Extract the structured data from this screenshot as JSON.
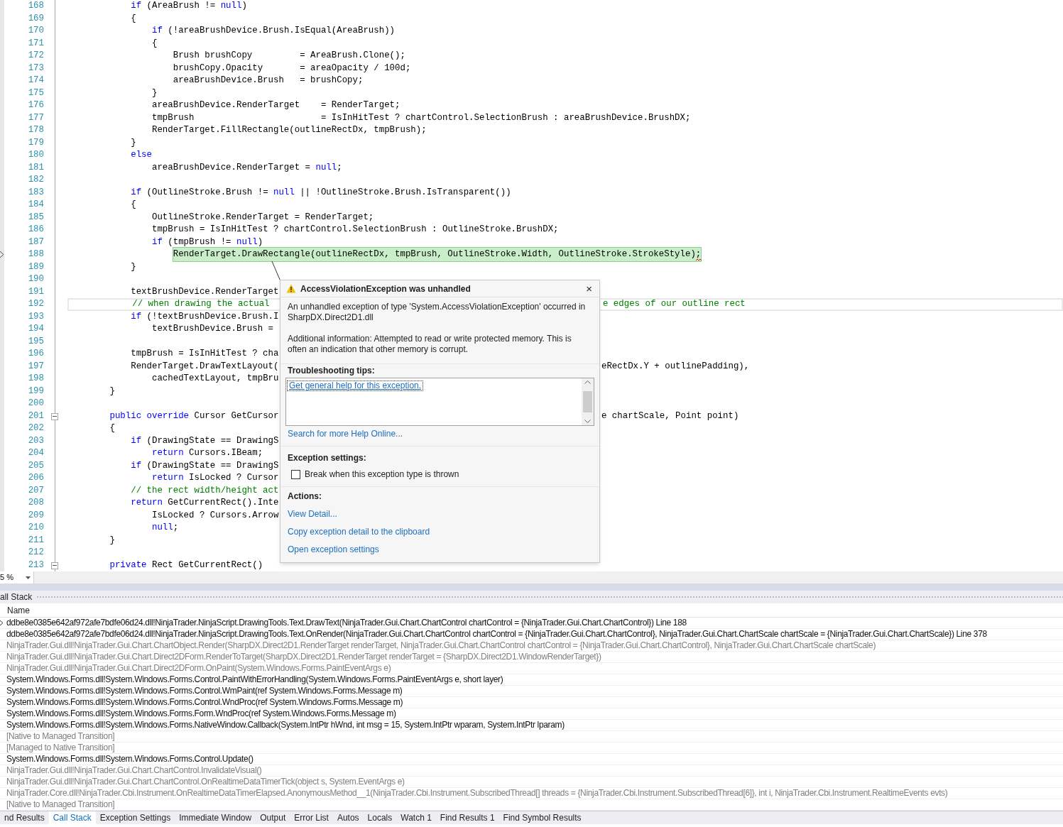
{
  "editor": {
    "lines": [
      {
        "number": "168",
        "fold": false,
        "cursor": false,
        "current": false,
        "parts": [
          {
            "text": "            if",
            "kind": "kw"
          },
          {
            "text": " (AreaBrush != ",
            "kind": "plain"
          },
          {
            "text": "null",
            "kind": "kw"
          },
          {
            "text": ")",
            "kind": "plain"
          }
        ]
      },
      {
        "number": "169",
        "fold": false,
        "cursor": false,
        "current": false,
        "parts": [
          {
            "text": "            {",
            "kind": "plain"
          }
        ]
      },
      {
        "number": "170",
        "fold": false,
        "cursor": false,
        "current": false,
        "parts": [
          {
            "text": "                if",
            "kind": "kw"
          },
          {
            "text": " (!areaBrushDevice.Brush.IsEqual(AreaBrush))",
            "kind": "plain"
          }
        ]
      },
      {
        "number": "171",
        "fold": false,
        "cursor": false,
        "current": false,
        "parts": [
          {
            "text": "                {",
            "kind": "plain"
          }
        ]
      },
      {
        "number": "172",
        "fold": false,
        "cursor": false,
        "current": false,
        "parts": [
          {
            "text": "                    Brush brushCopy         = AreaBrush.Clone();",
            "kind": "plain"
          }
        ]
      },
      {
        "number": "173",
        "fold": false,
        "cursor": false,
        "current": false,
        "parts": [
          {
            "text": "                    brushCopy.Opacity       = areaOpacity / 100d;",
            "kind": "plain"
          }
        ]
      },
      {
        "number": "174",
        "fold": false,
        "cursor": false,
        "current": false,
        "parts": [
          {
            "text": "                    areaBrushDevice.Brush   = brushCopy;",
            "kind": "plain"
          }
        ]
      },
      {
        "number": "175",
        "fold": false,
        "cursor": false,
        "current": false,
        "parts": [
          {
            "text": "                }",
            "kind": "plain"
          }
        ]
      },
      {
        "number": "176",
        "fold": false,
        "cursor": false,
        "current": false,
        "parts": [
          {
            "text": "                areaBrushDevice.RenderTarget    = RenderTarget;",
            "kind": "plain"
          }
        ]
      },
      {
        "number": "177",
        "fold": false,
        "cursor": false,
        "current": false,
        "parts": [
          {
            "text": "                tmpBrush                        = IsInHitTest ? chartControl.SelectionBrush : areaBrushDevice.BrushDX;",
            "kind": "plain"
          }
        ]
      },
      {
        "number": "178",
        "fold": false,
        "cursor": false,
        "current": false,
        "parts": [
          {
            "text": "                RenderTarget.FillRectangle(outlineRectDx, tmpBrush);",
            "kind": "plain"
          }
        ]
      },
      {
        "number": "179",
        "fold": false,
        "cursor": false,
        "current": false,
        "parts": [
          {
            "text": "            }",
            "kind": "plain"
          }
        ]
      },
      {
        "number": "180",
        "fold": false,
        "cursor": false,
        "current": false,
        "parts": [
          {
            "text": "            else",
            "kind": "kw"
          }
        ]
      },
      {
        "number": "181",
        "fold": false,
        "cursor": false,
        "current": false,
        "parts": [
          {
            "text": "                areaBrushDevice.RenderTarget = ",
            "kind": "plain"
          },
          {
            "text": "null",
            "kind": "kw"
          },
          {
            "text": ";",
            "kind": "plain"
          }
        ]
      },
      {
        "number": "182",
        "fold": false,
        "cursor": false,
        "current": false
      },
      {
        "number": "183",
        "fold": false,
        "cursor": false,
        "current": false,
        "parts": [
          {
            "text": "            if",
            "kind": "kw"
          },
          {
            "text": " (OutlineStroke.Brush != ",
            "kind": "plain"
          },
          {
            "text": "null",
            "kind": "kw"
          },
          {
            "text": " || !OutlineStroke.Brush.IsTransparent())",
            "kind": "plain"
          }
        ]
      },
      {
        "number": "184",
        "fold": false,
        "cursor": false,
        "current": false,
        "parts": [
          {
            "text": "            {",
            "kind": "plain"
          }
        ]
      },
      {
        "number": "185",
        "fold": false,
        "cursor": false,
        "current": false,
        "parts": [
          {
            "text": "                OutlineStroke.RenderTarget = RenderTarget;",
            "kind": "plain"
          }
        ]
      },
      {
        "number": "186",
        "fold": false,
        "cursor": false,
        "current": false,
        "parts": [
          {
            "text": "                tmpBrush = IsInHitTest ? chartControl.SelectionBrush : OutlineStroke.BrushDX;",
            "kind": "plain"
          }
        ]
      },
      {
        "number": "187",
        "fold": false,
        "cursor": false,
        "current": false,
        "parts": [
          {
            "text": "                if",
            "kind": "kw"
          },
          {
            "text": " (tmpBrush != ",
            "kind": "plain"
          },
          {
            "text": "null",
            "kind": "kw"
          },
          {
            "text": ")",
            "kind": "plain"
          }
        ]
      },
      {
        "number": "188",
        "fold": false,
        "cursor": false,
        "current": true,
        "parts": [
          {
            "text": "                    RenderTarget.DrawRectangle(outlineRectDx, tmpBrush, OutlineStroke.Width, OutlineStroke.StrokeStyle);",
            "kind": "plain"
          }
        ]
      },
      {
        "number": "189",
        "fold": false,
        "cursor": false,
        "current": false,
        "parts": [
          {
            "text": "            }",
            "kind": "plain"
          }
        ]
      },
      {
        "number": "190",
        "fold": false,
        "cursor": false,
        "current": false
      },
      {
        "number": "191",
        "fold": false,
        "cursor": false,
        "current": false,
        "parts": [
          {
            "text": "            textBrushDevice.RenderTarget",
            "kind": "plain"
          }
        ]
      },
      {
        "number": "192",
        "fold": false,
        "cursor": true,
        "current": false,
        "parts": [
          {
            "text": "            // when drawing the actual",
            "kind": "comment"
          }
        ],
        "after": [
          {
            "text": "e edges of our outline rect",
            "kind": "comment"
          }
        ]
      },
      {
        "number": "193",
        "fold": false,
        "cursor": false,
        "current": false,
        "parts": [
          {
            "text": "            if",
            "kind": "kw"
          },
          {
            "text": " (!textBrushDevice.Brush.I",
            "kind": "plain"
          }
        ]
      },
      {
        "number": "194",
        "fold": false,
        "cursor": false,
        "current": false,
        "parts": [
          {
            "text": "                textBrushDevice.Brush =",
            "kind": "plain"
          }
        ]
      },
      {
        "number": "195",
        "fold": false,
        "cursor": false,
        "current": false
      },
      {
        "number": "196",
        "fold": false,
        "cursor": false,
        "current": false,
        "parts": [
          {
            "text": "            tmpBrush = IsInHitTest ? cha",
            "kind": "plain"
          }
        ]
      },
      {
        "number": "197",
        "fold": false,
        "cursor": false,
        "current": false,
        "parts": [
          {
            "text": "            RenderTarget.DrawTextLayout(",
            "kind": "plain"
          }
        ],
        "after": [
          {
            "text": "eRectDx.Y + outlinePadding),",
            "kind": "plain"
          }
        ]
      },
      {
        "number": "198",
        "fold": false,
        "cursor": false,
        "current": false,
        "parts": [
          {
            "text": "                cachedTextLayout, tmpBru",
            "kind": "plain"
          }
        ]
      },
      {
        "number": "199",
        "fold": false,
        "cursor": false,
        "current": false,
        "parts": [
          {
            "text": "        }",
            "kind": "plain"
          }
        ]
      },
      {
        "number": "200",
        "fold": false,
        "cursor": false,
        "current": false
      },
      {
        "number": "201",
        "fold": true,
        "cursor": false,
        "current": false,
        "parts": [
          {
            "text": "        public",
            "kind": "kw"
          },
          {
            "text": " override",
            "kind": "kw"
          },
          {
            "text": " Cursor GetCursor",
            "kind": "plain"
          }
        ],
        "after": [
          {
            "text": "e chartScale, Point point)",
            "kind": "plain"
          }
        ]
      },
      {
        "number": "202",
        "fold": false,
        "cursor": false,
        "current": false,
        "parts": [
          {
            "text": "        {",
            "kind": "plain"
          }
        ]
      },
      {
        "number": "203",
        "fold": false,
        "cursor": false,
        "current": false,
        "parts": [
          {
            "text": "            if",
            "kind": "kw"
          },
          {
            "text": " (DrawingState == DrawingS",
            "kind": "plain"
          }
        ]
      },
      {
        "number": "204",
        "fold": false,
        "cursor": false,
        "current": false,
        "parts": [
          {
            "text": "                return",
            "kind": "kw"
          },
          {
            "text": " Cursors.IBeam;",
            "kind": "plain"
          }
        ]
      },
      {
        "number": "205",
        "fold": false,
        "cursor": false,
        "current": false,
        "parts": [
          {
            "text": "            if",
            "kind": "kw"
          },
          {
            "text": " (DrawingState == DrawingS",
            "kind": "plain"
          }
        ]
      },
      {
        "number": "206",
        "fold": false,
        "cursor": false,
        "current": false,
        "parts": [
          {
            "text": "                return",
            "kind": "kw"
          },
          {
            "text": " IsLocked ? Cursor",
            "kind": "plain"
          }
        ]
      },
      {
        "number": "207",
        "fold": false,
        "cursor": false,
        "current": false,
        "parts": [
          {
            "text": "            // the rect width/height act",
            "kind": "comment"
          }
        ]
      },
      {
        "number": "208",
        "fold": false,
        "cursor": false,
        "current": false,
        "parts": [
          {
            "text": "            return",
            "kind": "kw"
          },
          {
            "text": " GetCurrentRect().Inte",
            "kind": "plain"
          }
        ]
      },
      {
        "number": "209",
        "fold": false,
        "cursor": false,
        "current": false,
        "parts": [
          {
            "text": "                IsLocked ? Cursors.Arrow",
            "kind": "plain"
          }
        ]
      },
      {
        "number": "210",
        "fold": false,
        "cursor": false,
        "current": false,
        "parts": [
          {
            "text": "                null",
            "kind": "kw"
          },
          {
            "text": ";",
            "kind": "plain"
          }
        ]
      },
      {
        "number": "211",
        "fold": false,
        "cursor": false,
        "current": false,
        "parts": [
          {
            "text": "        }",
            "kind": "plain"
          }
        ]
      },
      {
        "number": "212",
        "fold": false,
        "cursor": false,
        "current": false
      },
      {
        "number": "213",
        "fold": true,
        "cursor": false,
        "current": false,
        "parts": [
          {
            "text": "        private",
            "kind": "kw"
          },
          {
            "text": " Rect GetCurrentRect()",
            "kind": "plain"
          }
        ]
      }
    ],
    "zoom": "5 %"
  },
  "dialog": {
    "title": "AccessViolationException was unhandled",
    "close": "×",
    "message": "An unhandled exception of type 'System.AccessViolationException' occurred in SharpDX.Direct2D1.dll",
    "additional": "Additional information: Attempted to read or write protected memory. This is often an indication that other memory is corrupt.",
    "tips_heading": "Troubleshooting tips:",
    "tips_link": "Get general help for this exception.",
    "search_link": "Search for more Help Online...",
    "settings_heading": "Exception settings:",
    "checkbox": {
      "label": "Break when this exception type is thrown",
      "checked": false
    },
    "actions_heading": "Actions:",
    "actions": [
      "View Detail...",
      "Copy exception detail to the clipboard",
      "Open exception settings"
    ]
  },
  "call_stack": {
    "title": "all Stack",
    "column": "Name",
    "rows": [
      {
        "text": "ddbe8e0385e642af972afe7bdfe06d24.dll!NinjaTrader.NinjaScript.DrawingTools.Text.DrawText(NinjaTrader.Gui.Chart.ChartControl chartControl = {NinjaTrader.Gui.Chart.ChartControl}) Line 188",
        "external": false,
        "current": true
      },
      {
        "text": "ddbe8e0385e642af972afe7bdfe06d24.dll!NinjaTrader.NinjaScript.DrawingTools.Text.OnRender(NinjaTrader.Gui.Chart.ChartControl chartControl = {NinjaTrader.Gui.Chart.ChartControl}, NinjaTrader.Gui.Chart.ChartScale chartScale = {NinjaTrader.Gui.Chart.ChartScale}) Line 378",
        "external": false,
        "current": false
      },
      {
        "text": "NinjaTrader.Gui.dll!NinjaTrader.Gui.Chart.ChartObject.Render(SharpDX.Direct2D1.RenderTarget renderTarget, NinjaTrader.Gui.Chart.ChartControl chartControl = {NinjaTrader.Gui.Chart.ChartControl}, NinjaTrader.Gui.Chart.ChartScale chartScale)",
        "external": true,
        "current": false
      },
      {
        "text": "NinjaTrader.Gui.dll!NinjaTrader.Gui.Chart.Direct2DForm.RenderToTarget(SharpDX.Direct2D1.RenderTarget renderTarget = {SharpDX.Direct2D1.WindowRenderTarget})",
        "external": true,
        "current": false
      },
      {
        "text": "NinjaTrader.Gui.dll!NinjaTrader.Gui.Chart.Direct2DForm.OnPaint(System.Windows.Forms.PaintEventArgs e)",
        "external": true,
        "current": false
      },
      {
        "text": "System.Windows.Forms.dll!System.Windows.Forms.Control.PaintWithErrorHandling(System.Windows.Forms.PaintEventArgs e, short layer)",
        "external": false,
        "current": false
      },
      {
        "text": "System.Windows.Forms.dll!System.Windows.Forms.Control.WmPaint(ref System.Windows.Forms.Message m)",
        "external": false,
        "current": false
      },
      {
        "text": "System.Windows.Forms.dll!System.Windows.Forms.Control.WndProc(ref System.Windows.Forms.Message m)",
        "external": false,
        "current": false
      },
      {
        "text": "System.Windows.Forms.dll!System.Windows.Forms.Form.WndProc(ref System.Windows.Forms.Message m)",
        "external": false,
        "current": false
      },
      {
        "text": "System.Windows.Forms.dll!System.Windows.Forms.NativeWindow.Callback(System.IntPtr hWnd, int msg = 15, System.IntPtr wparam, System.IntPtr lparam)",
        "external": false,
        "current": false
      },
      {
        "text": "[Native to Managed Transition]",
        "external": true,
        "current": false
      },
      {
        "text": "[Managed to Native Transition]",
        "external": true,
        "current": false
      },
      {
        "text": "System.Windows.Forms.dll!System.Windows.Forms.Control.Update()",
        "external": false,
        "current": false
      },
      {
        "text": "NinjaTrader.Gui.dll!NinjaTrader.Gui.Chart.ChartControl.InvalidateVisual()",
        "external": true,
        "current": false
      },
      {
        "text": "NinjaTrader.Gui.dll!NinjaTrader.Gui.Chart.ChartControl.OnRealtimeDataTimerTick(object s, System.EventArgs e)",
        "external": true,
        "current": false
      },
      {
        "text": "NinjaTrader.Core.dll!NinjaTrader.Cbi.Instrument.OnRealtimeDataTimerElapsed.AnonymousMethod__1(NinjaTrader.Cbi.Instrument.SubscribedThread[] threads = {NinjaTrader.Cbi.Instrument.SubscribedThread[6]}, int i, NinjaTrader.Cbi.Instrument.RealtimeEvents evts)",
        "external": true,
        "current": false
      },
      {
        "text": "[Native to Managed Transition]",
        "external": true,
        "current": false
      }
    ]
  },
  "tabs": [
    {
      "label": "nd Results",
      "selected": false
    },
    {
      "label": "Call Stack",
      "selected": true
    },
    {
      "label": "Exception Settings",
      "selected": false
    },
    {
      "label": "Immediate Window",
      "selected": false
    },
    {
      "label": "Output",
      "selected": false
    },
    {
      "label": "Error List",
      "selected": false
    },
    {
      "label": "Autos",
      "selected": false
    },
    {
      "label": "Locals",
      "selected": false
    },
    {
      "label": "Watch 1",
      "selected": false
    },
    {
      "label": "Find Results 1",
      "selected": false
    },
    {
      "label": "Find Symbol Results",
      "selected": false
    }
  ]
}
